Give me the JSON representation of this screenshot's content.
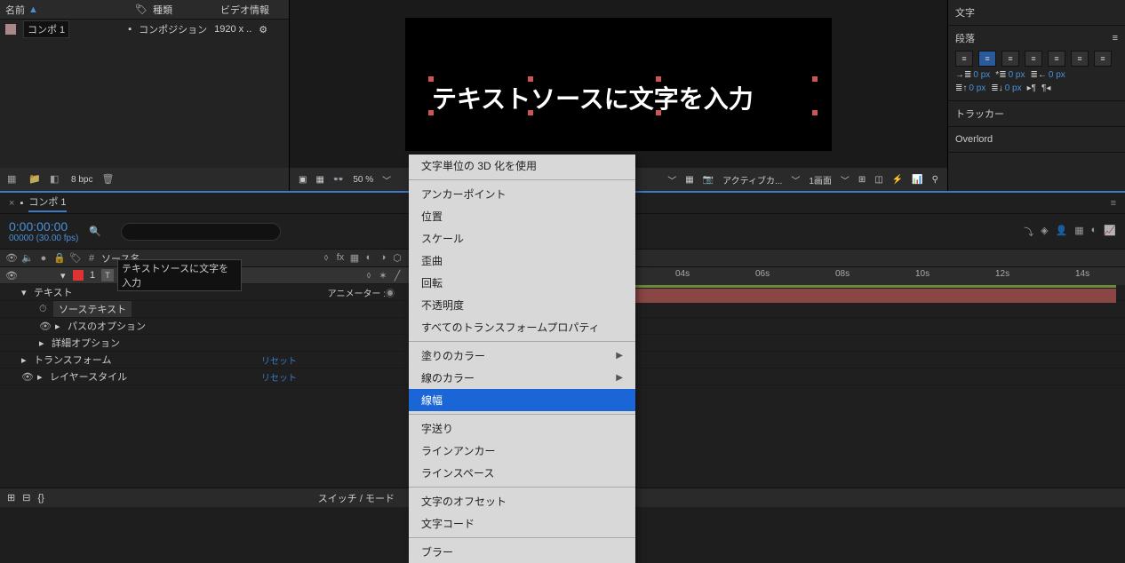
{
  "project": {
    "cols": {
      "name": "名前",
      "tag": "種類",
      "info": "ビデオ情報"
    },
    "comp": {
      "name": "コンポ 1",
      "type": "コンポジション",
      "info": "1920 x .."
    },
    "footer": {
      "bpc": "8 bpc"
    }
  },
  "viewer": {
    "text": "テキストソースに文字を入力",
    "zoom": "50 %",
    "camera": "アクティブカ...",
    "views": "1画面"
  },
  "panels": {
    "char": "文字",
    "para": "段落",
    "px": "0 px",
    "tracker": "トラッカー",
    "overlord": "Overlord"
  },
  "timeline": {
    "tab": "コンポ 1",
    "timecode": "0:00:00:00",
    "frames": "00000 (30.00 fps)",
    "sourcename": "ソース名",
    "switchmode": "スイッチ / モード",
    "animator": "アニメーター :",
    "reset": "リセット",
    "ruler": [
      "04s",
      "06s",
      "08s",
      "10s",
      "12s",
      "14s"
    ],
    "layers": {
      "idx": "1",
      "name": "テキストソースに文字を入力",
      "text": "テキスト",
      "source": "ソーステキスト",
      "path": "パスのオプション",
      "detail": "詳細オプション",
      "transform": "トランスフォーム",
      "style": "レイヤースタイル"
    },
    "num": "#"
  },
  "menu": {
    "g1": [
      "文字単位の 3D 化を使用"
    ],
    "g2": [
      "アンカーポイント",
      "位置",
      "スケール",
      "歪曲",
      "回転",
      "不透明度",
      "すべてのトランスフォームプロパティ"
    ],
    "g3": [
      {
        "label": "塗りのカラー",
        "sub": true
      },
      {
        "label": "線のカラー",
        "sub": true
      },
      {
        "label": "線幅",
        "sub": false,
        "hl": true
      }
    ],
    "g4": [
      "字送り",
      "ラインアンカー",
      "ラインスペース"
    ],
    "g5": [
      "文字のオフセット",
      "文字コード"
    ],
    "g6": [
      "ブラー"
    ]
  }
}
